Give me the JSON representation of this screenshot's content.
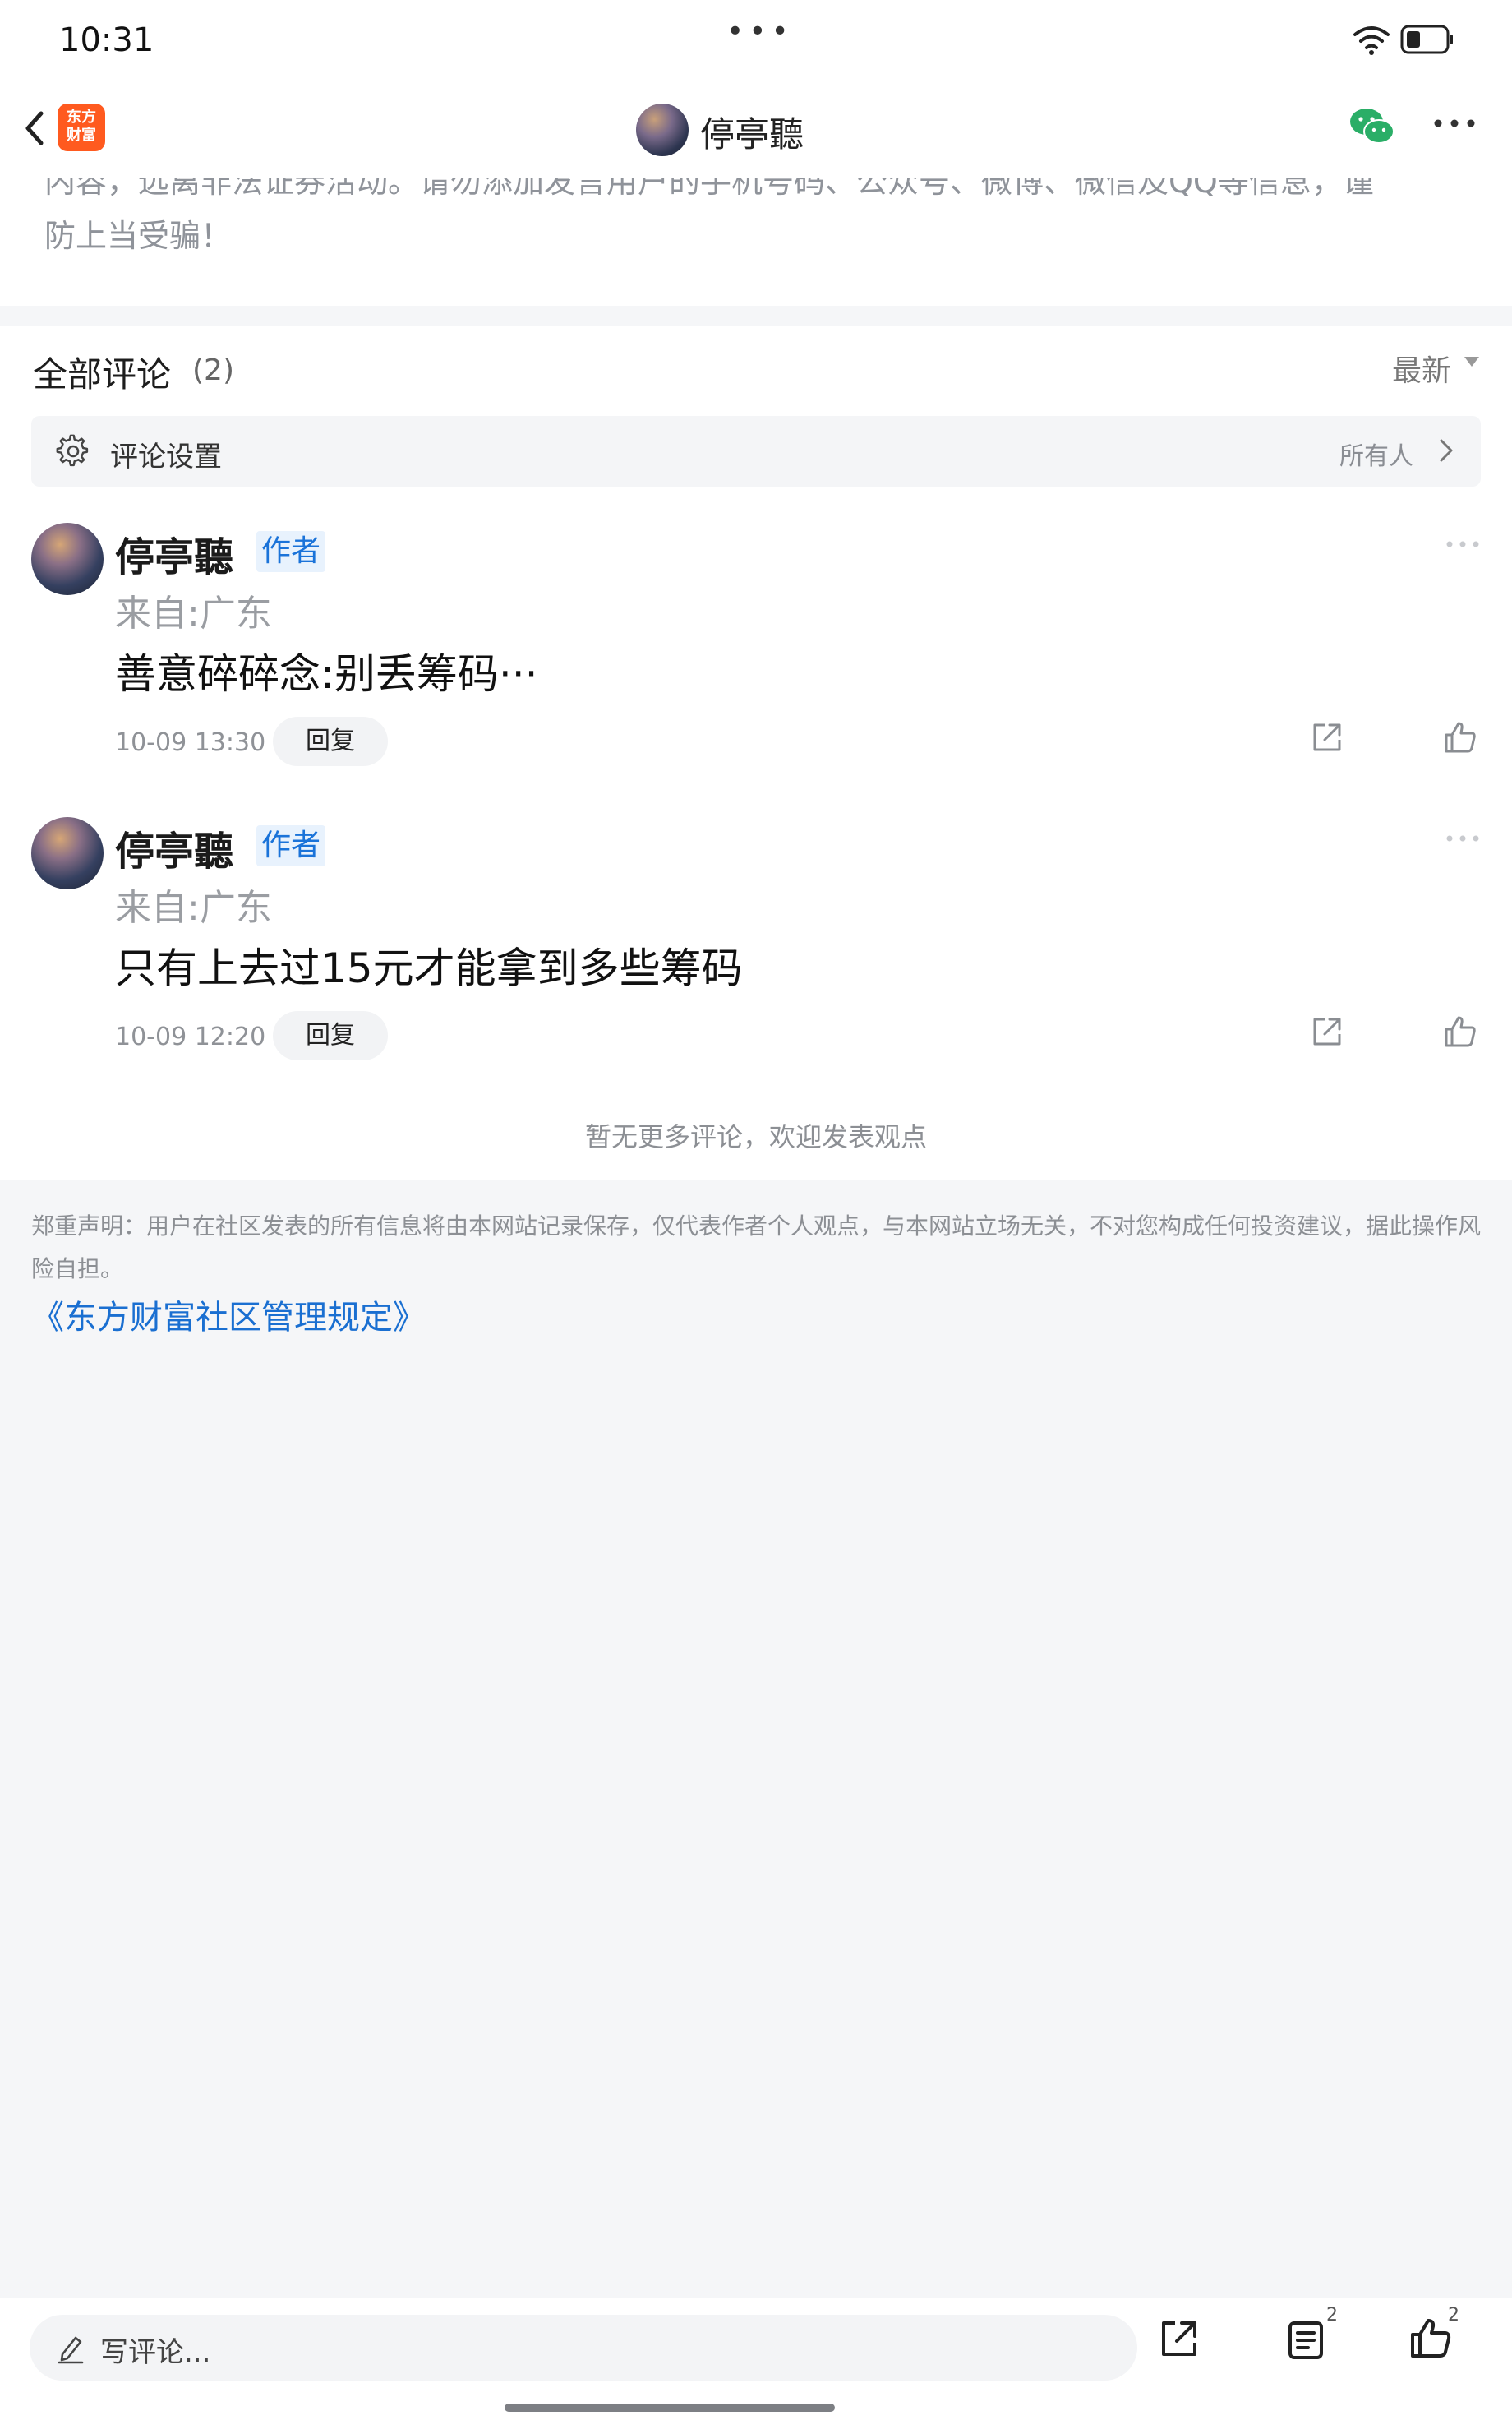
{
  "status_bar": {
    "time": "10:31",
    "center_dots": "•••"
  },
  "nav": {
    "logo_text_top": "东方",
    "logo_text_bottom": "财富",
    "title": "停亭聽"
  },
  "notice": {
    "line1": "内容，远离非法证券活动。请勿添加发言用户的手机号码、公众号、微博、微信及QQ等信息，谨",
    "line2": "防上当受骗！"
  },
  "comments_section": {
    "title": "全部评论",
    "count": "(2)",
    "sort": "最新",
    "settings_label": "评论设置",
    "settings_audience": "所有人",
    "no_more": "暂无更多评论，欢迎发表观点"
  },
  "comments": [
    {
      "name": "停亭聽",
      "badge": "作者",
      "location": "来自:广东",
      "content": "善意碎碎念:别丢筹码···",
      "time": "10-09 13:30",
      "reply": "回复"
    },
    {
      "name": "停亭聽",
      "badge": "作者",
      "location": "来自:广东",
      "content": "只有上去过15元才能拿到多些筹码",
      "time": "10-09 12:20",
      "reply": "回复"
    }
  ],
  "disclaimer": {
    "text": "郑重声明：用户在社区发表的所有信息将由本网站记录保存，仅代表作者个人观点，与本网站立场无关，不对您构成任何投资建议，据此操作风险自担。",
    "rules_link": "《东方财富社区管理规定》"
  },
  "bottom_bar": {
    "placeholder": "写评论...",
    "list_count": "2",
    "like_count": "2"
  },
  "colors": {
    "brand_orange": "#ff5a1f",
    "author_badge": "#1a73d9",
    "link": "#1a6fd1",
    "wechat_green": "#2aae67"
  }
}
